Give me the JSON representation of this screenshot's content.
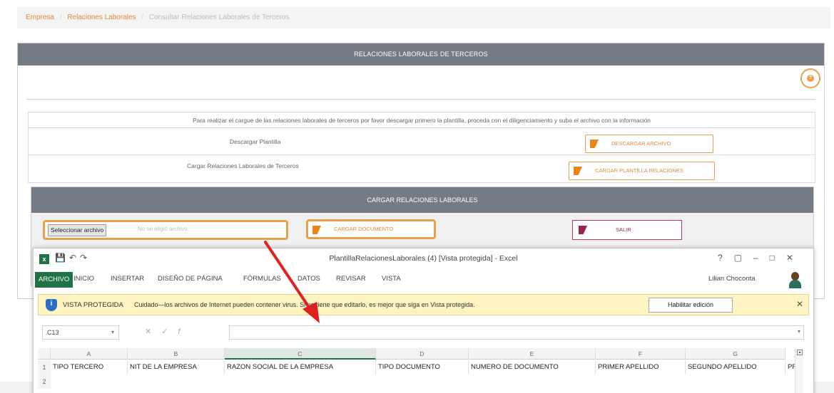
{
  "breadcrumb": {
    "items": [
      "Empresa",
      "Relaciones Laborales",
      "Consultar Relaciones Laborales de Terceros"
    ],
    "separator": "/"
  },
  "panel": {
    "title": "RELACIONES LABORALES DE TERCEROS",
    "instructions": "Para realizar el cargue de las relaciones laborales de terceros por favor descargar primero la plantilla, proceda con el diligenciamiento y suba el archivo con la información",
    "download_label": "Descargar Plantilla",
    "download_button": "DESCARGAR ARCHIVO",
    "upload_label": "Cargar Relaciones Laborales de Terceros",
    "upload_button": "CARGAR PLANTILLA RELACIONES"
  },
  "sub_panel": {
    "title": "CARGAR RELACIONES LABORALES",
    "file_button": "Seleccionar archivo",
    "file_status": "No se eligió archivo",
    "load_button": "CARGAR DOCUMENTO",
    "exit_button": "SALIR"
  },
  "excel": {
    "window_title": "PlantillaRelacionesLaborales (4)  [Vista protegida] - Excel",
    "tabs": [
      "ARCHIVO",
      "INICIO",
      "INSERTAR",
      "DISEÑO DE PÁGINA",
      "FÓRMULAS",
      "DATOS",
      "REVISAR",
      "VISTA"
    ],
    "user": "Lilian Choconta",
    "protected_title": "VISTA PROTEGIDA",
    "protected_message": "Cuidado—los archivos de Internet pueden contener virus. Si no tiene que editarlo, es mejor que siga en Vista protegida.",
    "enable_button": "Habilitar edición",
    "name_box": "C13",
    "formula": "",
    "columns": [
      "A",
      "B",
      "C",
      "D",
      "E",
      "F",
      "G"
    ],
    "rows": [
      "1",
      "2"
    ],
    "row1": [
      "TIPO TERCERO",
      "NIT DE LA EMPRESA",
      "RAZON SOCIAL DE LA EMPRESA",
      "TIPO DOCUMENTO",
      "NUMERO DE DOCUMENTO",
      "PRIMER APELLIDO",
      "SEGUNDO APELLIDO",
      "PR"
    ]
  },
  "colors": {
    "accent_orange": "#e8a04a",
    "header_gray": "#757b84",
    "excel_green": "#217346",
    "exit_red": "#9c2540",
    "arrow_red": "#e02020"
  },
  "icons": {
    "help": "help-icon",
    "shield": "shield-icon",
    "excel": "excel-icon"
  }
}
